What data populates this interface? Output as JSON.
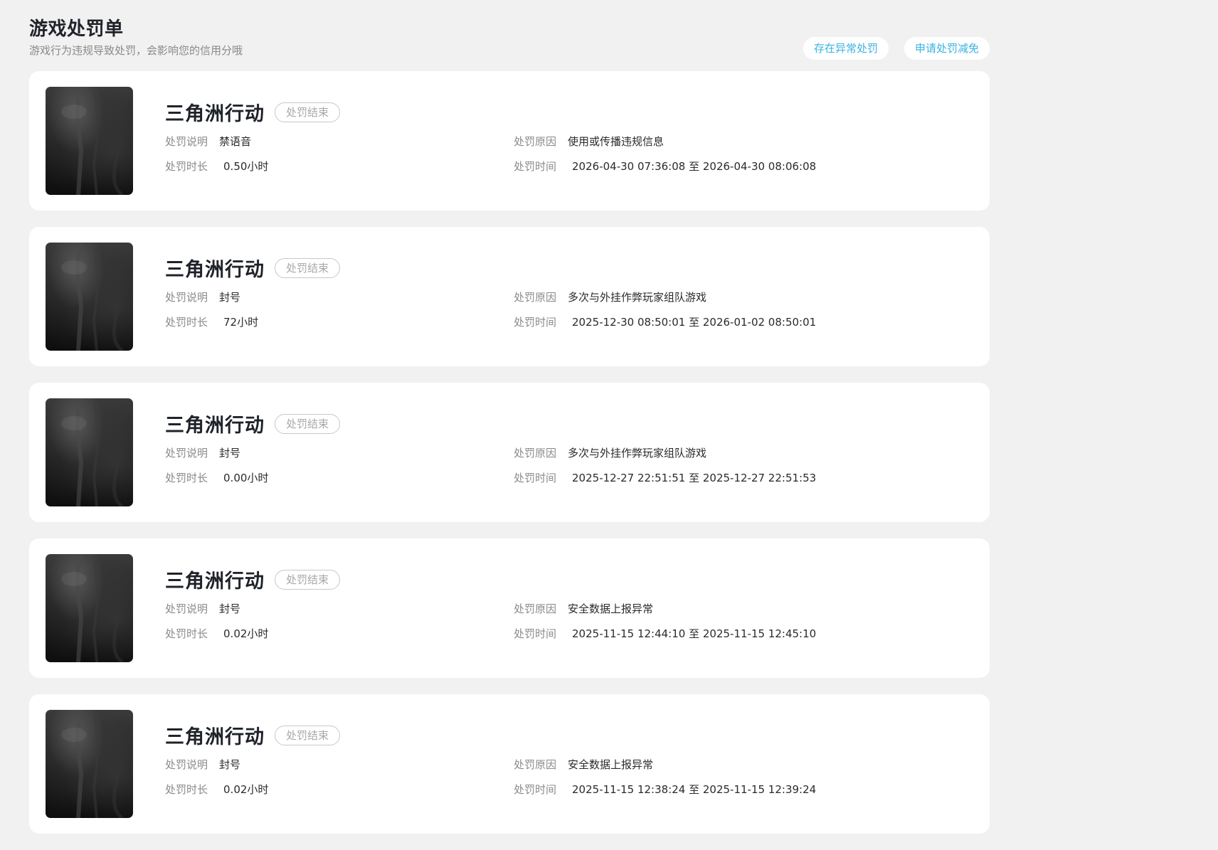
{
  "header": {
    "title": "游戏处罚单",
    "subtitle": "游戏行为违规导致处罚，会影响您的信用分哦",
    "actions": {
      "abnormal_label": "存在异常处罚",
      "reduce_label": "申请处罚减免"
    }
  },
  "labels": {
    "description": "处罚说明",
    "duration": "处罚时长",
    "reason": "处罚原因",
    "time": "处罚时间"
  },
  "records": [
    {
      "game": "三角洲行动",
      "status": "处罚结束",
      "description": "禁语音",
      "duration": "0.50小时",
      "reason": "使用或传播违规信息",
      "time": "2026-04-30 07:36:08 至 2026-04-30 08:06:08"
    },
    {
      "game": "三角洲行动",
      "status": "处罚结束",
      "description": "封号",
      "duration": "72小时",
      "reason": "多次与外挂作弊玩家组队游戏",
      "time": "2025-12-30 08:50:01 至 2026-01-02 08:50:01"
    },
    {
      "game": "三角洲行动",
      "status": "处罚结束",
      "description": "封号",
      "duration": "0.00小时",
      "reason": "多次与外挂作弊玩家组队游戏",
      "time": "2025-12-27 22:51:51 至 2025-12-27 22:51:53"
    },
    {
      "game": "三角洲行动",
      "status": "处罚结束",
      "description": "封号",
      "duration": "0.02小时",
      "reason": "安全数据上报异常",
      "time": "2025-11-15 12:44:10 至 2025-11-15 12:45:10"
    },
    {
      "game": "三角洲行动",
      "status": "处罚结束",
      "description": "封号",
      "duration": "0.02小时",
      "reason": "安全数据上报异常",
      "time": "2025-11-15 12:38:24 至 2025-11-15 12:39:24"
    }
  ],
  "colors": {
    "background": "#f1f1f1",
    "card": "#ffffff",
    "accent": "#3ab2e0",
    "label": "#8a8a8a",
    "title": "#1f2329"
  }
}
